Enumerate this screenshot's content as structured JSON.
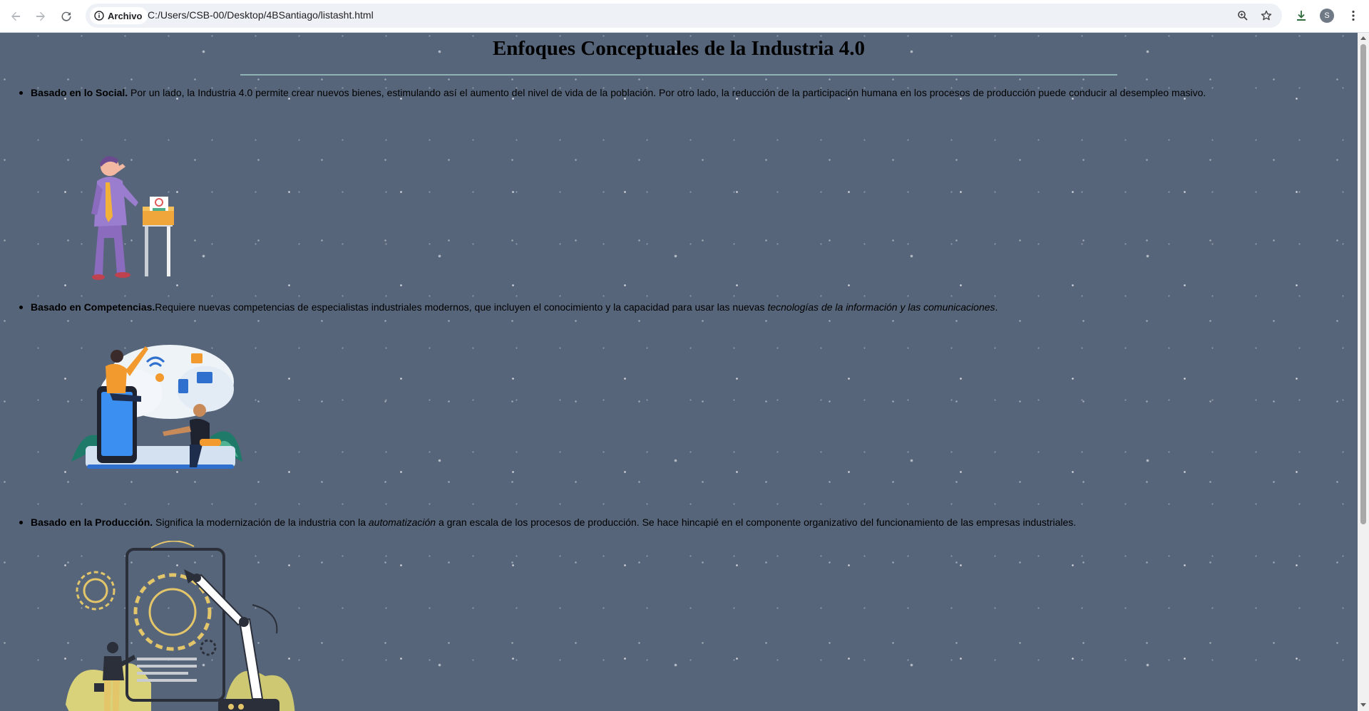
{
  "browser": {
    "back_icon": "arrow-left-icon",
    "forward_icon": "arrow-right-icon",
    "reload_icon": "reload-icon",
    "chip_label": "Archivo",
    "chip_icon": "info-icon",
    "url": "C:/Users/CSB-00/Desktop/4BSantiago/listasht.html",
    "zoom_icon": "zoom-icon",
    "bookmark_icon": "star-icon",
    "download_icon": "download-icon",
    "profile_initial": "S",
    "menu_icon": "kebab-menu-icon"
  },
  "page": {
    "title": "Enfoques Conceptuales de la Industria 4.0",
    "background_color": "#56657a",
    "rule_color": "#8fb3b5",
    "items": [
      {
        "lead": "Basado en lo Social.",
        "text": " Por un lado, la Industria 4.0 permite crear nuevos bienes, estimulando así el aumento del nivel de vida de la población. Por otro lado, la reducción de la participación humana en los procesos de producción puede conducir al desempleo masivo.",
        "illustration": "worried-businessman-illustration"
      },
      {
        "lead": "Basado en Competencias.",
        "text_before": "Requiere nuevas competencias de especialistas industriales modernos, que incluyen el conocimiento y la capacidad para usar las nuevas ",
        "emphasis": "tecnologías de la información y las comunicaciones",
        "text_after": ".",
        "illustration": "digital-skills-illustration"
      },
      {
        "lead": "Basado en la Producción.",
        "text_before": " Significa la modernización de la industria con la ",
        "emphasis": "automatización",
        "text_after": " a gran escala de los procesos de producción. Se hace hincapié en el componente organizativo del funcionamiento de las empresas industriales.",
        "illustration": "robot-arm-automation-illustration"
      }
    ]
  }
}
